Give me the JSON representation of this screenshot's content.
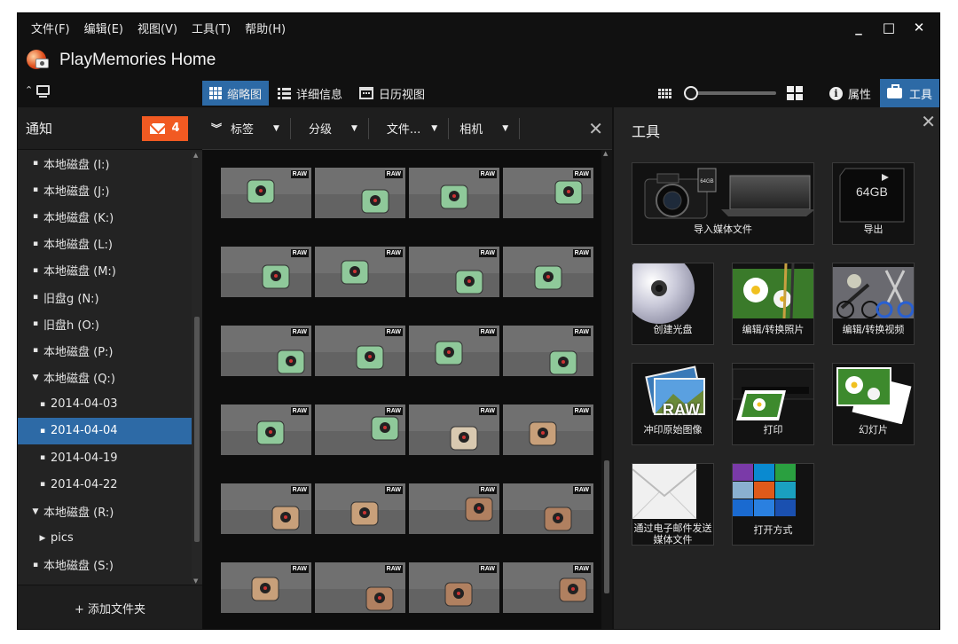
{
  "menu": [
    "文件(F)",
    "编辑(E)",
    "视图(V)",
    "工具(T)",
    "帮助(H)"
  ],
  "window_controls": [
    "_",
    "□",
    "✕"
  ],
  "app": {
    "title": "PlayMemories Home"
  },
  "viewbar": {
    "tabs": [
      {
        "label": "缩略图",
        "active": true
      },
      {
        "label": "详细信息",
        "active": false
      },
      {
        "label": "日历视图",
        "active": false
      }
    ],
    "zoom_level": 0,
    "properties_label": "属性",
    "tools_label": "工具"
  },
  "left": {
    "notifications_label": "通知",
    "notification_count": "4",
    "tree": [
      {
        "label": "本地磁盘 (I:)",
        "mark": "▪",
        "indent": 0,
        "selected": false
      },
      {
        "label": "本地磁盘 (J:)",
        "mark": "▪",
        "indent": 0,
        "selected": false
      },
      {
        "label": "本地磁盘 (K:)",
        "mark": "▪",
        "indent": 0,
        "selected": false
      },
      {
        "label": "本地磁盘 (L:)",
        "mark": "▪",
        "indent": 0,
        "selected": false
      },
      {
        "label": "本地磁盘 (M:)",
        "mark": "▪",
        "indent": 0,
        "selected": false
      },
      {
        "label": "旧盘g (N:)",
        "mark": "▪",
        "indent": 0,
        "selected": false
      },
      {
        "label": "旧盘h (O:)",
        "mark": "▪",
        "indent": 0,
        "selected": false
      },
      {
        "label": "本地磁盘 (P:)",
        "mark": "▪",
        "indent": 0,
        "selected": false
      },
      {
        "label": "本地磁盘 (Q:)",
        "mark": "▼",
        "indent": 0,
        "selected": false
      },
      {
        "label": "2014-04-03",
        "mark": "▪",
        "indent": 1,
        "selected": false
      },
      {
        "label": "2014-04-04",
        "mark": "▪",
        "indent": 1,
        "selected": true
      },
      {
        "label": "2014-04-19",
        "mark": "▪",
        "indent": 1,
        "selected": false
      },
      {
        "label": "2014-04-22",
        "mark": "▪",
        "indent": 1,
        "selected": false
      },
      {
        "label": "本地磁盘 (R:)",
        "mark": "▼",
        "indent": 0,
        "selected": false
      },
      {
        "label": "pics",
        "mark": "▶",
        "indent": 1,
        "selected": false
      },
      {
        "label": "本地磁盘 (S:)",
        "mark": "▪",
        "indent": 0,
        "selected": false
      }
    ],
    "add_folder_label": "+ 添加文件夹"
  },
  "filters": [
    "标签",
    "分级",
    "文件...",
    "相机"
  ],
  "raw_badge": "RAW",
  "thumbnail_rows": [
    [
      "#8fc99a",
      "#8fc99a",
      "#8fc99a",
      "#8fc99a"
    ],
    [
      "#8fc99a",
      "#8fc99a",
      "#8fc99a",
      "#8fc99a"
    ],
    [
      "#8fc99a",
      "#8fc99a",
      "#8fc99a",
      "#8fc99a"
    ],
    [
      "#8fc99a",
      "#8fc99a",
      "#d9c9b0",
      "#c8a07a"
    ],
    [
      "#c8a07a",
      "#c8a07a",
      "#b08060",
      "#b08060"
    ],
    [
      "#c8a07a",
      "#b08060",
      "#b08060",
      "#b08060"
    ]
  ],
  "tools": {
    "title": "工具",
    "items": [
      {
        "label": "导入媒体文件",
        "icon": "camera-laptop-icon"
      },
      {
        "label": "导出",
        "icon": "sd-card-icon",
        "card_text": "64GB"
      },
      {
        "label": "创建光盘",
        "icon": "disc-icon"
      },
      {
        "label": "编辑/转换照片",
        "icon": "photo-edit-icon"
      },
      {
        "label": "编辑/转换视频",
        "icon": "video-edit-icon"
      },
      {
        "label": "冲印原始图像",
        "icon": "raw-print-icon",
        "raw_text": "RAW"
      },
      {
        "label": "打印",
        "icon": "printer-icon"
      },
      {
        "label": "幻灯片",
        "icon": "slideshow-icon"
      },
      {
        "label": "通过电子邮件发送媒体文件",
        "icon": "envelope-icon"
      },
      {
        "label": "打开方式",
        "icon": "open-with-icon"
      }
    ]
  },
  "colors": {
    "accent": "#2d6aa6",
    "badge": "#f15a22"
  }
}
